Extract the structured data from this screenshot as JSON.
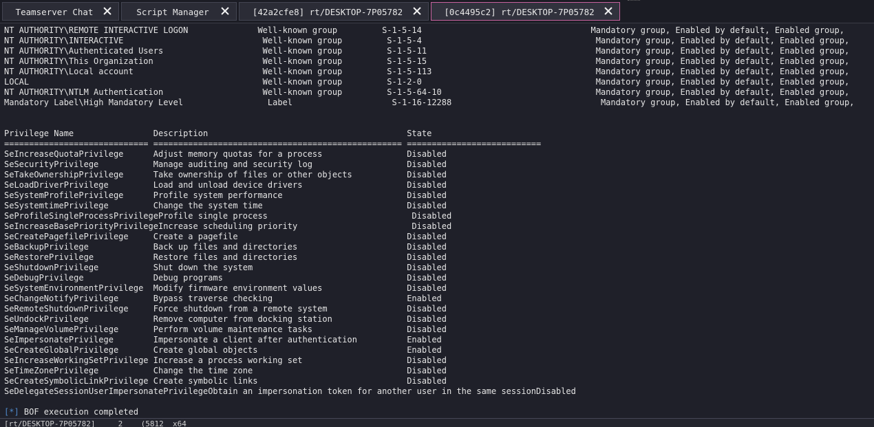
{
  "tabs": [
    {
      "label": "Teamserver Chat",
      "active": false
    },
    {
      "label": "Script Manager",
      "active": false
    },
    {
      "label": "[42a2cfe8] rt/DESKTOP-7P05782",
      "active": false
    },
    {
      "label": "[0c4495c2] rt/DESKTOP-7P05782",
      "active": true
    }
  ],
  "console": {
    "groups": [
      "NT AUTHORITY\\REMOTE INTERACTIVE LOGON              Well-known group         S-1-5-14                                  Mandatory group, Enabled by default, Enabled group,",
      "NT AUTHORITY\\INTERACTIVE                            Well-known group         S-1-5-4                                   Mandatory group, Enabled by default, Enabled group,",
      "NT AUTHORITY\\Authenticated Users                    Well-known group         S-1-5-11                                  Mandatory group, Enabled by default, Enabled group,",
      "NT AUTHORITY\\This Organization                      Well-known group         S-1-5-15                                  Mandatory group, Enabled by default, Enabled group,",
      "NT AUTHORITY\\Local account                          Well-known group         S-1-5-113                                 Mandatory group, Enabled by default, Enabled group,",
      "LOCAL                                               Well-known group         S-1-2-0                                   Mandatory group, Enabled by default, Enabled group,",
      "NT AUTHORITY\\NTLM Authentication                    Well-known group         S-1-5-64-10                               Mandatory group, Enabled by default, Enabled group,",
      "Mandatory Label\\High Mandatory Level                 Label                    S-1-16-12288                              Mandatory group, Enabled by default, Enabled group,"
    ],
    "priv_header": "Privilege Name                Description                                        State",
    "priv_rule": "============================= ================================================== ===========================",
    "privileges": [
      "SeIncreaseQuotaPrivilege      Adjust memory quotas for a process                 Disabled",
      "SeSecurityPrivilege           Manage auditing and security log                   Disabled",
      "SeTakeOwnershipPrivilege      Take ownership of files or other objects           Disabled",
      "SeLoadDriverPrivilege         Load and unload device drivers                     Disabled",
      "SeSystemProfilePrivilege      Profile system performance                         Disabled",
      "SeSystemtimePrivilege         Change the system time                             Disabled",
      "SeProfileSingleProcessPrivilegeProfile single process                             Disabled",
      "SeIncreaseBasePriorityPrivilegeIncrease scheduling priority                       Disabled",
      "SeCreatePagefilePrivilege     Create a pagefile                                  Disabled",
      "SeBackupPrivilege             Back up files and directories                      Disabled",
      "SeRestorePrivilege            Restore files and directories                      Disabled",
      "SeShutdownPrivilege           Shut down the system                               Disabled",
      "SeDebugPrivilege              Debug programs                                     Disabled",
      "SeSystemEnvironmentPrivilege  Modify firmware environment values                 Disabled",
      "SeChangeNotifyPrivilege       Bypass traverse checking                           Enabled",
      "SeRemoteShutdownPrivilege     Force shutdown from a remote system                Disabled",
      "SeUndockPrivilege             Remove computer from docking station               Disabled",
      "SeManageVolumePrivilege       Perform volume maintenance tasks                   Disabled",
      "SeImpersonatePrivilege        Impersonate a client after authentication          Enabled",
      "SeCreateGlobalPrivilege       Create global objects                              Enabled",
      "SeIncreaseWorkingSetPrivilege Increase a process working set                     Disabled",
      "SeTimeZonePrivilege           Change the time zone                               Disabled",
      "SeCreateSymbolicLinkPrivilege Create symbolic links                              Disabled",
      "SeDelegateSessionUserImpersonatePrivilegeObtain an impersonation token for another user in the same sessionDisabled"
    ],
    "completion_marker": "[*]",
    "completion_text": " BOF execution completed"
  },
  "status_bar": "[rt/DESKTOP-7P05782]     2    (5812  x64",
  "colors": {
    "background": "#1f2029",
    "active_tab_border": "#c7629e",
    "marker": "#4f88c9"
  }
}
